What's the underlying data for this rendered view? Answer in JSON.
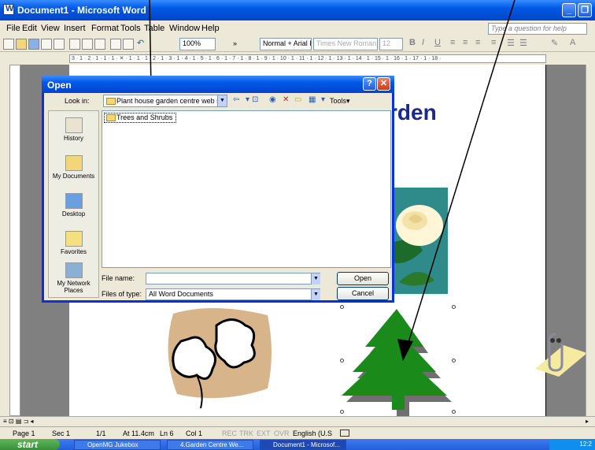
{
  "window": {
    "title": "Document1 - Microsoft Word",
    "minimize": "_",
    "restore": "❐"
  },
  "menu": [
    "File",
    "Edit",
    "View",
    "Insert",
    "Format",
    "Tools",
    "Table",
    "Window",
    "Help"
  ],
  "help_box_placeholder": "Type a question for help",
  "toolbar": {
    "zoom": "100%",
    "style": "Normal + Arial I",
    "font": "Times New Roman",
    "size": "12",
    "bold": "B",
    "italic": "I",
    "underline": "U"
  },
  "ruler_text": "3 · 1 · 2 · 1 · 1 · 1 · ✕ · 1 · 1 · 1 · 2 · 1 · 3 · 1 · 4 · 1 · 5 · 1 · 6 · 1 · 7 · 1 · 8 · 1 · 9 · 1 · 10 · 1 · 11 · 1 · 12 · 1 · 13 · 1 · 14 · 1 · 15 · 1 · 16 · 1 · 17 · 1 · 18 ·",
  "document": {
    "heading_fragment": "rden"
  },
  "dialog": {
    "title": "Open",
    "help": "?",
    "close": "✕",
    "look_in_label": "Look in:",
    "look_in_value": "Plant house garden centre web site",
    "tools_label": "Tools",
    "places": [
      "History",
      "My Documents",
      "Desktop",
      "Favorites",
      "My Network Places"
    ],
    "files": [
      "Trees and Shrubs"
    ],
    "file_name_label": "File name:",
    "file_name_value": "",
    "file_type_label": "Files of type:",
    "file_type_value": "All Word Documents",
    "open_button": "Open",
    "cancel_button": "Cancel"
  },
  "status": {
    "page": "Page 1",
    "sec": "Sec 1",
    "pages": "1/1",
    "at": "At 11.4cm",
    "ln": "Ln 6",
    "col": "Col 1",
    "rec": "REC",
    "trk": "TRK",
    "ext": "EXT",
    "ovr": "OVR",
    "lang": "English (U.S"
  },
  "taskbar": {
    "start": "start",
    "tasks": [
      "OpenMG Jukebox",
      "4.Garden Centre We...",
      "Document1 - Microsof..."
    ],
    "clock": "12:2"
  },
  "colors": {
    "heading": "#1a2a8c",
    "tree": "#1a8a1a",
    "xp_blue": "#0058e6"
  }
}
